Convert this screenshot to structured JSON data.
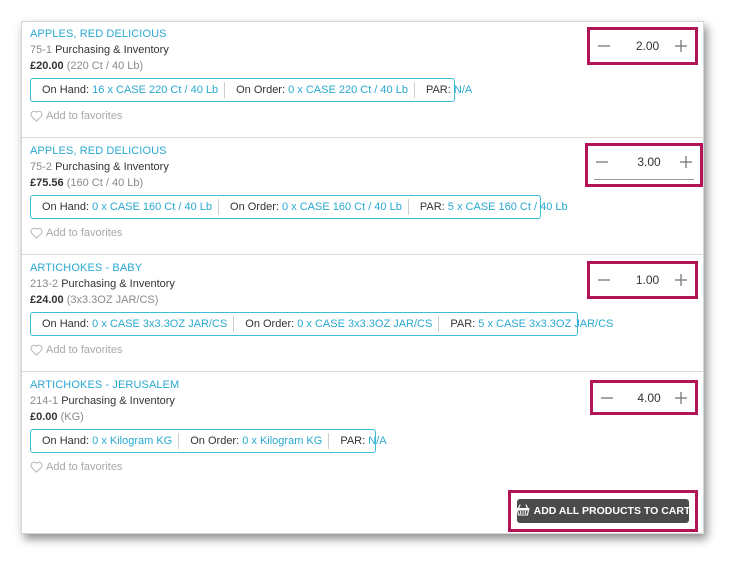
{
  "products": [
    {
      "name": "APPLES, RED DELICIOUS",
      "code": "75-1",
      "category": "Purchasing & Inventory",
      "price": "£20.00",
      "unit": "(220 Ct / 40 Lb)",
      "on_hand_label": "On Hand:",
      "on_hand_value": "16 x CASE 220 Ct / 40 Lb",
      "on_order_label": "On Order:",
      "on_order_value": "0 x CASE 220 Ct / 40 Lb",
      "par_label": "PAR:",
      "par_value": "N/A",
      "favorites_label": "Add to favorites",
      "quantity": "2.00"
    },
    {
      "name": "APPLES, RED DELICIOUS",
      "code": "75-2",
      "category": "Purchasing & Inventory",
      "price": "£75.56",
      "unit": "(160 Ct / 40 Lb)",
      "on_hand_label": "On Hand:",
      "on_hand_value": "0 x CASE 160 Ct / 40 Lb",
      "on_order_label": "On Order:",
      "on_order_value": "0 x CASE 160 Ct / 40 Lb",
      "par_label": "PAR:",
      "par_value": "5 x CASE 160 Ct / 40 Lb",
      "favorites_label": "Add to favorites",
      "quantity": "3.00"
    },
    {
      "name": "ARTICHOKES - BABY",
      "code": "213-2",
      "category": "Purchasing & Inventory",
      "price": "£24.00",
      "unit": "(3x3.3OZ JAR/CS)",
      "on_hand_label": "On Hand:",
      "on_hand_value": "0 x CASE 3x3.3OZ JAR/CS",
      "on_order_label": "On Order:",
      "on_order_value": "0 x CASE 3x3.3OZ JAR/CS",
      "par_label": "PAR:",
      "par_value": "5 x CASE 3x3.3OZ JAR/CS",
      "favorites_label": "Add to favorites",
      "quantity": "1.00"
    },
    {
      "name": "ARTICHOKES - JERUSALEM",
      "code": "214-1",
      "category": "Purchasing & Inventory",
      "price": "£0.00",
      "unit": "(KG)",
      "on_hand_label": "On Hand:",
      "on_hand_value": "0 x Kilogram KG",
      "on_order_label": "On Order:",
      "on_order_value": "0 x Kilogram KG",
      "par_label": "PAR:",
      "par_value": "N/A",
      "favorites_label": "Add to favorites",
      "quantity": "4.00"
    }
  ],
  "cart": {
    "button_label": "ADD ALL PRODUCTS TO CART",
    "icon": "basket-icon"
  },
  "icons": {
    "decrement": "minus-icon",
    "increment": "plus-icon",
    "favorite": "heart-outline-icon"
  },
  "colors": {
    "link": "#29a9d2",
    "highlight": "#b11457",
    "stock_border": "#3bbdd6",
    "cart_button": "#4b4b4b"
  }
}
